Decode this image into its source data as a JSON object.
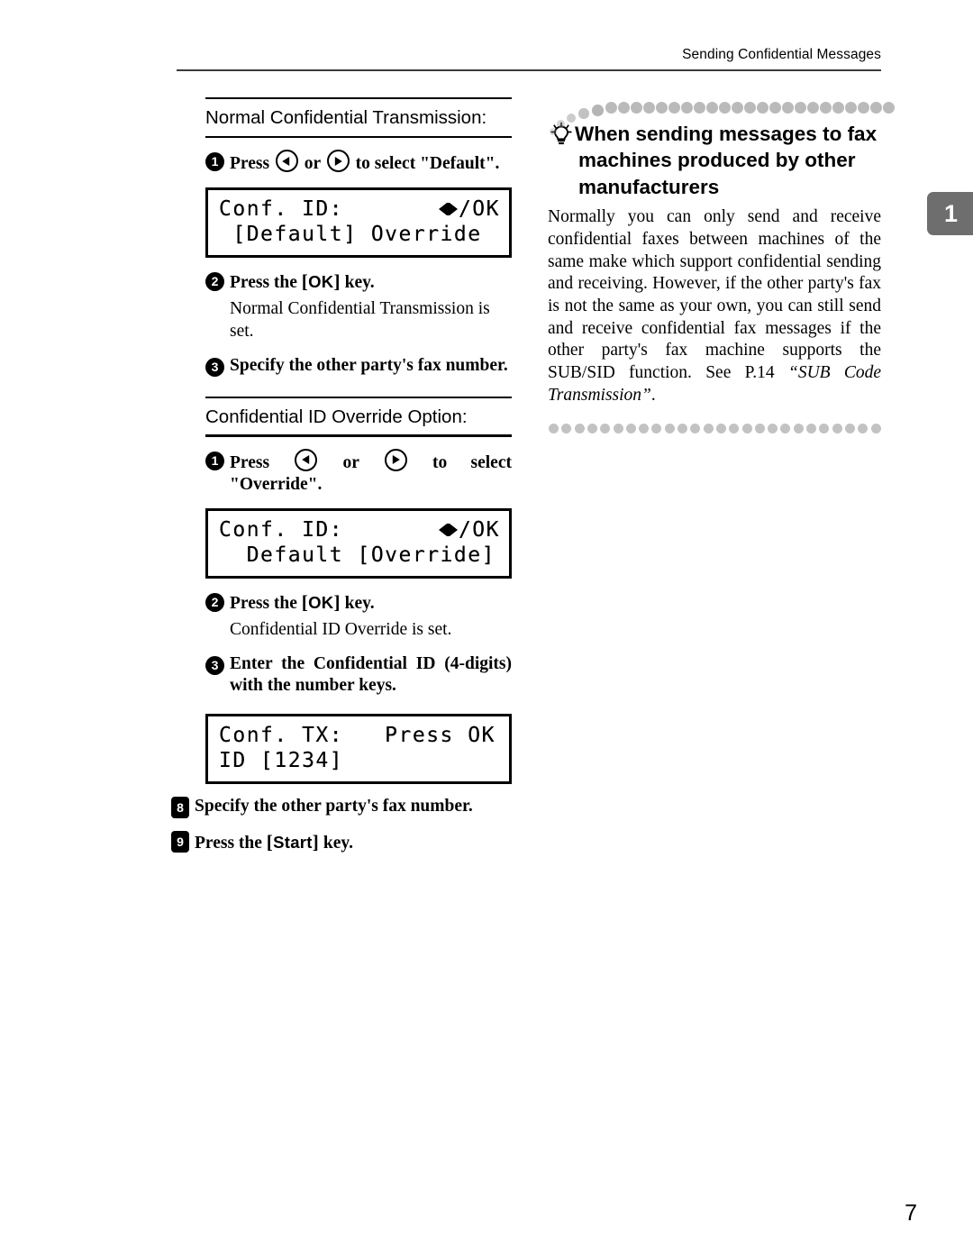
{
  "header": {
    "running_head": "Sending Confidential Messages"
  },
  "chapter_tab": {
    "number": "1"
  },
  "left_column": {
    "sections": [
      {
        "title": "Normal Confidential Transmission:",
        "steps": [
          {
            "marker": "1",
            "marker_style": "circle",
            "text_before": "Press",
            "icon_left": "arrow-left-icon",
            "text_mid": "or",
            "icon_right": "arrow-right-icon",
            "text_after": "to select \"Default\"."
          },
          {
            "marker": "2",
            "marker_style": "circle",
            "text_before": "Press the",
            "key": "OK",
            "text_after": "key.",
            "note": "Normal Confidential Transmission is set."
          },
          {
            "marker": "3",
            "marker_style": "circle",
            "text": "Specify the other party's fax number."
          }
        ],
        "lcd": {
          "line1_left": "Conf. ID:",
          "line1_right": "/OK",
          "line2": " [Default] Override"
        }
      },
      {
        "title": "Confidential ID Override Option:",
        "steps": [
          {
            "marker": "1",
            "marker_style": "circle",
            "text_before": "Press",
            "icon_left": "arrow-left-icon",
            "text_mid": "or",
            "icon_right": "arrow-right-icon",
            "text_after": "to select \"Override\"."
          },
          {
            "marker": "2",
            "marker_style": "circle",
            "text_before": "Press the",
            "key": "OK",
            "text_after": "key.",
            "note": "Confidential ID Override is set."
          },
          {
            "marker": "3",
            "marker_style": "circle",
            "text": "Enter the Confidential ID (4-digits) with the number keys."
          }
        ],
        "lcd": {
          "line1_left": "Conf. ID:",
          "line1_right": "/OK",
          "line2": "  Default [Override]"
        }
      }
    ],
    "final_lcd": {
      "line1": "Conf. TX:   Press OK",
      "line2": "ID [1234]"
    },
    "final_steps": [
      {
        "marker": "8",
        "marker_style": "square",
        "text": "Specify the other party's fax number."
      },
      {
        "marker": "9",
        "marker_style": "square",
        "text_before": "Press the",
        "key": "Start",
        "text_after": "key."
      }
    ]
  },
  "right_column": {
    "tip": {
      "icon": "lightbulb-icon",
      "heading": "When sending messages to fax machines produced by other manufacturers",
      "body_part1": "Normally you can only send and receive confidential faxes between machines of the same make which support confidential sending and receiving. However, if the other party's fax is not the same as your own, you can still send and receive confidential fax messages if the other party's fax machine supports the SUB/SID function. See P.14 ",
      "body_italic": "“SUB Code Transmission”",
      "body_part2": "."
    }
  },
  "folio": {
    "page_number": "7"
  }
}
